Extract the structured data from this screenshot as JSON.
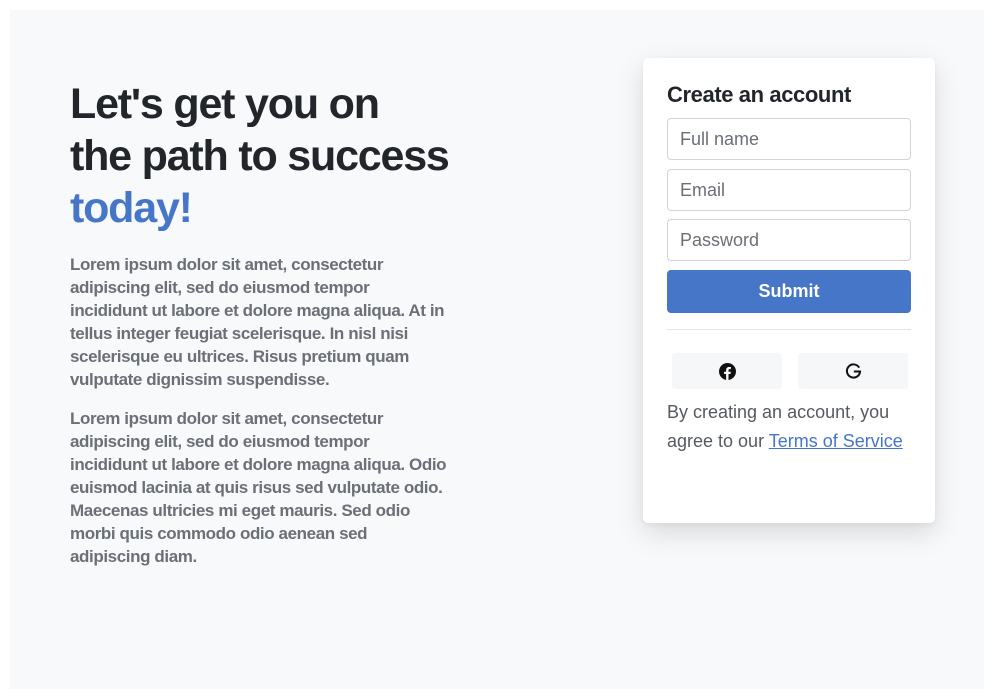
{
  "hero": {
    "heading_main": "Let's get you on the path to success",
    "heading_accent": "today!",
    "paragraphs": [
      "Lorem ipsum dolor sit amet, consectetur adipiscing elit, sed do eiusmod tempor incididunt ut labore et dolore magna aliqua. At in tellus integer feugiat scelerisque. In nisl nisi scelerisque eu ultrices. Risus pretium quam vulputate dignissim suspendisse.",
      "Lorem ipsum dolor sit amet, consectetur adipiscing elit, sed do eiusmod tempor incididunt ut labore et dolore magna aliqua. Odio euismod lacinia at quis risus sed vulputate odio. Maecenas ultricies mi eget mauris. Sed odio morbi quis commodo odio aenean sed adipiscing diam."
    ]
  },
  "form": {
    "title": "Create an account",
    "full_name_placeholder": "Full name",
    "email_placeholder": "Email",
    "password_placeholder": "Password",
    "submit_label": "Submit",
    "social": [
      {
        "icon": "facebook-icon"
      },
      {
        "icon": "google-icon"
      }
    ],
    "terms_prefix": "By creating an account, you agree to our ",
    "terms_link": "Terms of Service"
  },
  "colors": {
    "accent": "#4676c8",
    "heading": "#22252a",
    "body_text": "#6b6f76",
    "background": "#f8f9fb"
  }
}
